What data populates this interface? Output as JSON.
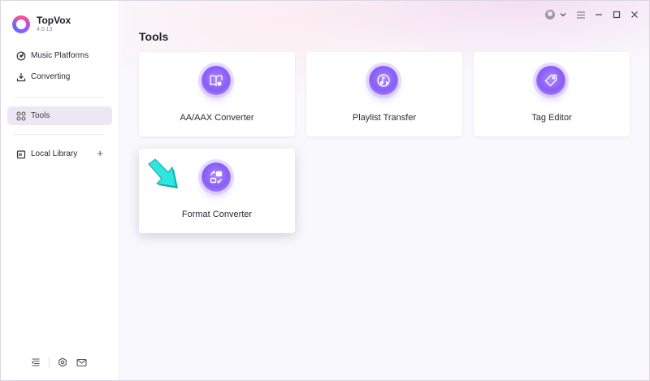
{
  "app": {
    "name": "TopVox",
    "version": "4.0.13"
  },
  "sidebar": {
    "items": [
      {
        "label": "Music Platforms",
        "icon": "music-platform-icon"
      },
      {
        "label": "Converting",
        "icon": "download-icon"
      },
      {
        "label": "Tools",
        "icon": "grid-icon",
        "active": true
      },
      {
        "label": "Local Library",
        "icon": "library-icon"
      }
    ],
    "add_label": "+",
    "bottom_icons": [
      "collapse-icon",
      "settings-icon",
      "mail-icon"
    ]
  },
  "topbar": {
    "icons": [
      "avatar",
      "chevron-down-icon",
      "menu-icon",
      "minimize-icon",
      "maximize-icon",
      "close-icon"
    ]
  },
  "main": {
    "title": "Tools",
    "tools": [
      {
        "label": "AA/AAX Converter",
        "icon": "book-icon"
      },
      {
        "label": "Playlist Transfer",
        "icon": "music-note-icon"
      },
      {
        "label": "Tag Editor",
        "icon": "tag-icon"
      },
      {
        "label": "Format Converter",
        "icon": "convert-icon"
      }
    ]
  },
  "colors": {
    "accent": "#8a5cf6",
    "active_bg": "#ebe8f3",
    "pointer_arrow": "#19d3d3"
  }
}
